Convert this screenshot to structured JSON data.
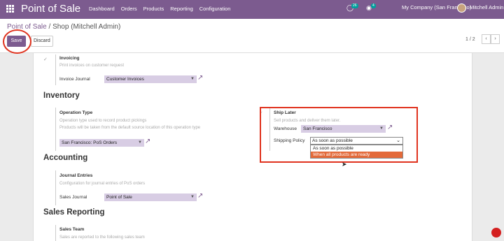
{
  "topbar": {
    "app_title": "Point of Sale",
    "menu": [
      "Dashboard",
      "Orders",
      "Products",
      "Reporting",
      "Configuration"
    ],
    "chat_count": "26",
    "activity_count": "4",
    "company": "My Company (San Francisco)",
    "user": "Mitchell Admin"
  },
  "control": {
    "breadcrumb_parent": "Point of Sale",
    "breadcrumb_sep": "/",
    "breadcrumb_current": "Shop (Mitchell Admin)",
    "save_label": "Save",
    "discard_label": "Discard",
    "pager": "1 / 2",
    "prev": "‹",
    "next": "›"
  },
  "invoicing": {
    "title": "Invoicing",
    "desc": "Print invoices on customer request",
    "journal_label": "Invoice Journal",
    "journal_value": "Customer Invoices"
  },
  "inventory": {
    "heading": "Inventory",
    "op_title": "Operation Type",
    "op_desc1": "Operation type used to record product pickings",
    "op_desc2": "Products will be taken from the default source location of this operation type",
    "op_value": "San Francisco: PoS Orders",
    "ship_title": "Ship Later",
    "ship_desc": "Sell products and deliver them later.",
    "warehouse_label": "Warehouse",
    "warehouse_value": "San Francisco",
    "policy_label": "Shipping Policy",
    "policy_value": "As soon as possible",
    "policy_options": [
      "As soon as possible",
      "When all products are ready"
    ]
  },
  "accounting": {
    "heading": "Accounting",
    "je_title": "Journal Entries",
    "je_desc": "Configuration for journal entries of PoS orders",
    "sales_journal_label": "Sales Journal",
    "sales_journal_value": "Point of Sale"
  },
  "sales_reporting": {
    "heading": "Sales Reporting",
    "team_title": "Sales Team",
    "team_desc": "Sales are reported to the following sales team"
  },
  "colors": {
    "brand": "#7c5b8f",
    "highlight": "#e0331f",
    "selected_option": "#e36a3a"
  }
}
